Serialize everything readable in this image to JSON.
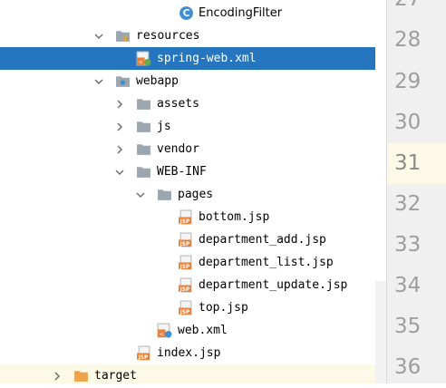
{
  "tree": {
    "rows": [
      {
        "label": "EncodingFilter",
        "icon": "java-class-icon",
        "chevron": null
      },
      {
        "label": "resources",
        "icon": "resources-folder-icon",
        "chevron": "down"
      },
      {
        "label": "spring-web.xml",
        "icon": "spring-config-icon",
        "chevron": null,
        "selected": true
      },
      {
        "label": "webapp",
        "icon": "web-folder-icon",
        "chevron": "down"
      },
      {
        "label": "assets",
        "icon": "folder-icon",
        "chevron": "right"
      },
      {
        "label": "js",
        "icon": "folder-icon",
        "chevron": "right"
      },
      {
        "label": "vendor",
        "icon": "folder-icon",
        "chevron": "right"
      },
      {
        "label": "WEB-INF",
        "icon": "folder-icon",
        "chevron": "down"
      },
      {
        "label": "pages",
        "icon": "folder-icon",
        "chevron": "down"
      },
      {
        "label": "bottom.jsp",
        "icon": "jsp-file-icon",
        "chevron": null
      },
      {
        "label": "department_add.jsp",
        "icon": "jsp-file-icon",
        "chevron": null
      },
      {
        "label": "department_list.jsp",
        "icon": "jsp-file-icon",
        "chevron": null
      },
      {
        "label": "department_update.jsp",
        "icon": "jsp-file-icon",
        "chevron": null
      },
      {
        "label": "top.jsp",
        "icon": "jsp-file-icon",
        "chevron": null
      },
      {
        "label": "web.xml",
        "icon": "web-xml-icon",
        "chevron": null
      },
      {
        "label": "index.jsp",
        "icon": "jsp-file-icon",
        "chevron": null
      },
      {
        "label": "target",
        "icon": "excluded-folder-icon",
        "chevron": "right"
      }
    ]
  },
  "gutter": {
    "line_numbers": [
      "27",
      "28",
      "29",
      "30",
      "31",
      "32",
      "33",
      "34",
      "35",
      "36"
    ],
    "current_line": "31"
  },
  "colors": {
    "selection": "#2675bf",
    "current_line_highlight": "#fcfae6",
    "folder": "#9aa7b0",
    "target_folder": "#f0a24a",
    "jsp": "#e8803a",
    "class_icon": "#3d8fd6"
  }
}
